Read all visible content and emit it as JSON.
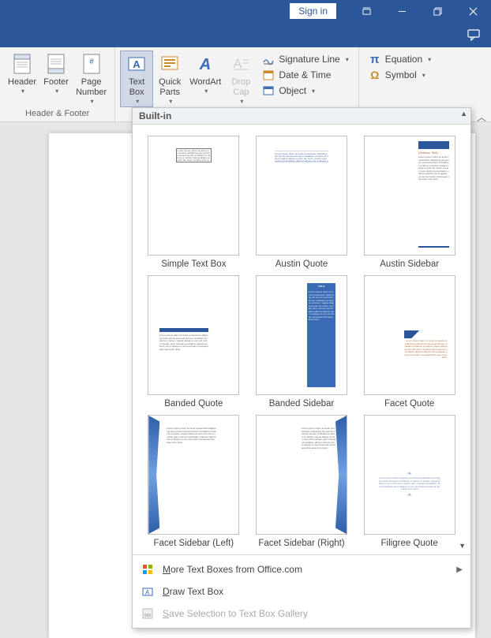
{
  "titlebar": {
    "signin": "Sign in"
  },
  "ribbon": {
    "group_header_footer": {
      "label": "Header & Footer",
      "header": "Header",
      "footer": "Footer",
      "page_number": "Page\nNumber"
    },
    "group_text": {
      "text_box": "Text\nBox",
      "quick_parts": "Quick\nParts",
      "wordart": "WordArt",
      "drop_cap": "Drop\nCap",
      "signature_line": "Signature Line",
      "date_time": "Date & Time",
      "object": "Object"
    },
    "group_symbols": {
      "equation": "Equation",
      "symbol": "Symbol"
    }
  },
  "gallery": {
    "section": "Built-in",
    "items": [
      {
        "label": "Simple Text Box"
      },
      {
        "label": "Austin Quote"
      },
      {
        "label": "Austin Sidebar",
        "sidebar_title": "[Sidebar Title]"
      },
      {
        "label": "Banded Quote"
      },
      {
        "label": "Banded Sidebar"
      },
      {
        "label": "Facet Quote"
      },
      {
        "label": "Facet Sidebar (Left)"
      },
      {
        "label": "Facet Sidebar (Right)"
      },
      {
        "label": "Filigree Quote"
      }
    ],
    "menu": {
      "more": "More Text Boxes from Office.com",
      "draw": "Draw Text Box",
      "save": "Save Selection to Text Box Gallery"
    }
  },
  "placeholder_text": "Lorem ipsum dolor sit amet consectetur adipiscing elit sed do eiusmod tempor incididunt ut labore et dolore magna aliqua ut enim ad minim veniam quis nostrud exercitation ullamco laboris nisi ut aliquip ex ea commodo consequat duis aute irure dolor"
}
